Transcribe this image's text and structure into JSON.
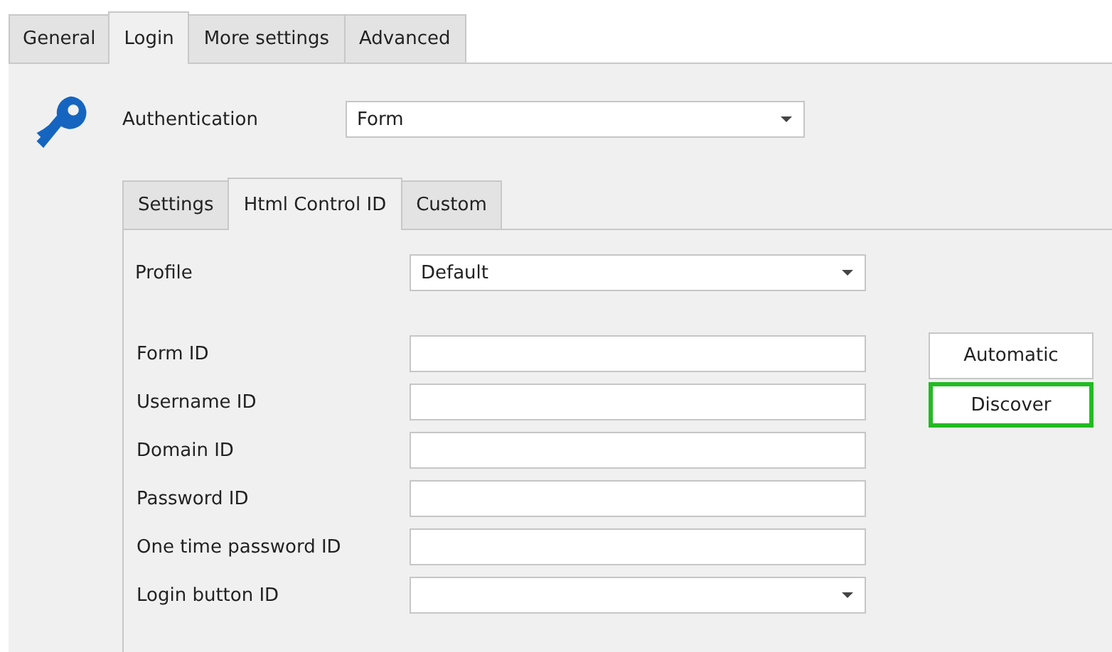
{
  "tabs": [
    {
      "label": "General",
      "selected": false
    },
    {
      "label": "Login",
      "selected": true
    },
    {
      "label": "More settings",
      "selected": false
    },
    {
      "label": "Advanced",
      "selected": false
    }
  ],
  "authentication": {
    "label": "Authentication",
    "value": "Form"
  },
  "inner_tabs": [
    {
      "label": "Settings",
      "selected": false
    },
    {
      "label": "Html Control ID",
      "selected": true
    },
    {
      "label": "Custom",
      "selected": false
    }
  ],
  "profile": {
    "label": "Profile",
    "value": "Default"
  },
  "fields": [
    {
      "label": "Form ID",
      "kind": "text"
    },
    {
      "label": "Username ID",
      "kind": "text"
    },
    {
      "label": "Domain ID",
      "kind": "text"
    },
    {
      "label": "Password ID",
      "kind": "text"
    },
    {
      "label": "One time password ID",
      "kind": "text"
    },
    {
      "label": "Login button ID",
      "kind": "dropdown"
    }
  ],
  "buttons": [
    {
      "label": "Automatic",
      "highlighted": false
    },
    {
      "label": "Discover",
      "highlighted": true
    }
  ]
}
